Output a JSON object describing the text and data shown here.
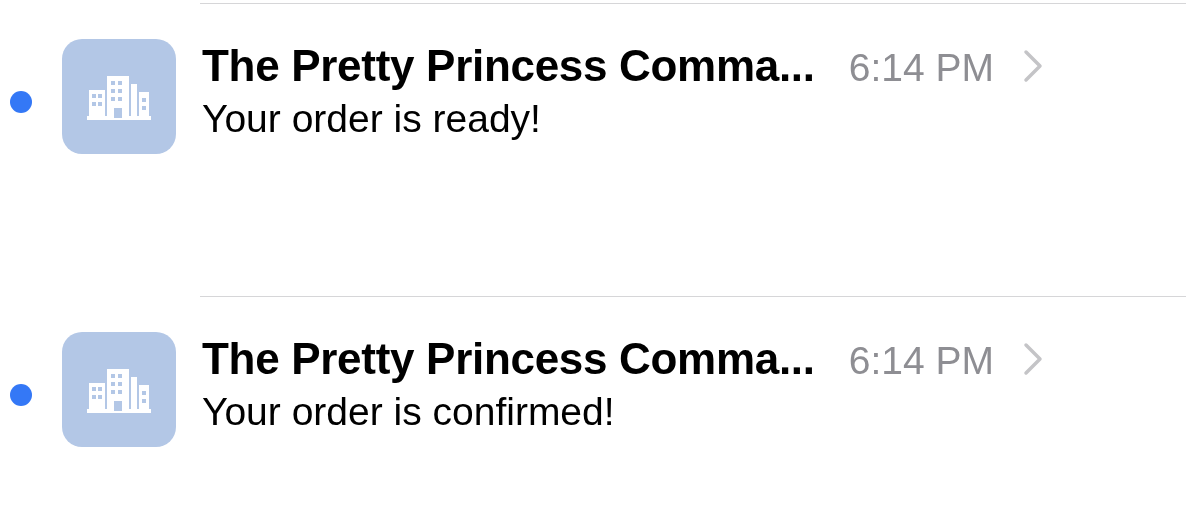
{
  "messages": [
    {
      "unread": true,
      "sender": "The Pretty Princess Comma...",
      "time": "6:14 PM",
      "preview": "Your order is ready!"
    },
    {
      "unread": true,
      "sender": "The Pretty Princess Comma...",
      "time": "6:14 PM",
      "preview": "Your order is confirmed!"
    }
  ]
}
